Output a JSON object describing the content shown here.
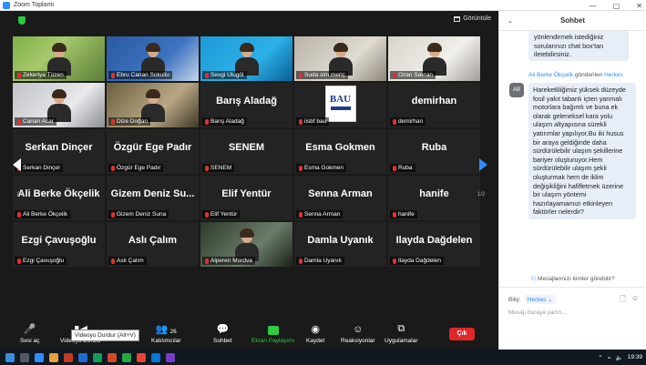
{
  "window": {
    "title": "Zoom Toplantı",
    "controls": [
      "—",
      "▢",
      "✕"
    ]
  },
  "view_button": {
    "label": "Görüntüle"
  },
  "pager": {
    "left": "1/2",
    "right": "1/2"
  },
  "tiles": [
    {
      "name": "Zekeriya Tüzen",
      "type": "video",
      "video_class": "v1"
    },
    {
      "name": "Ebru Canan Sokullu",
      "type": "video",
      "video_class": "v2"
    },
    {
      "name": "Sevgi Ulugöl",
      "type": "video",
      "video_class": "v3"
    },
    {
      "name": "Suda sim meriç",
      "type": "video",
      "video_class": "v4"
    },
    {
      "name": "Ozan Savran",
      "type": "video",
      "video_class": "v5"
    },
    {
      "name": "Canan Acar",
      "type": "video",
      "video_class": "v6"
    },
    {
      "name": "Dize Doğan",
      "type": "video",
      "video_class": "v7",
      "active": true
    },
    {
      "name": "Barış Aladağ",
      "big": "Barış Aladağ",
      "type": "name"
    },
    {
      "name": "iisbf bau",
      "type": "logo",
      "logo_text": "BAU"
    },
    {
      "name": "demirhan",
      "big": "demirhan",
      "type": "name"
    },
    {
      "name": "Serkan Dinçer",
      "big": "Serkan Dinçer",
      "type": "name"
    },
    {
      "name": "Özgür Ege Padır",
      "big": "Özgür Ege Padır",
      "type": "name"
    },
    {
      "name": "SENEM",
      "big": "SENEM",
      "type": "name"
    },
    {
      "name": "Esma Gokmen",
      "big": "Esma Gokmen",
      "type": "name"
    },
    {
      "name": "Ruba",
      "big": "Ruba",
      "type": "name"
    },
    {
      "name": "Ali Berke Ökçelik",
      "big": "Ali Berke Ökçelik",
      "type": "name"
    },
    {
      "name": "Gizem Deniz Suna",
      "big": "Gizem Deniz Su...",
      "type": "name"
    },
    {
      "name": "Elif Yentür",
      "big": "Elif Yentür",
      "type": "name"
    },
    {
      "name": "Senna Arman",
      "big": "Senna Arman",
      "type": "name"
    },
    {
      "name": "hanife",
      "big": "hanife",
      "type": "name"
    },
    {
      "name": "Ezgi Çavuşoğlu",
      "big": "Ezgi Çavuşoğlu",
      "type": "name"
    },
    {
      "name": "Aslı Çalım",
      "big": "Aslı Çalım",
      "type": "name"
    },
    {
      "name": "Alperen Mordva",
      "type": "video",
      "video_class": "v8"
    },
    {
      "name": "Damla Uyanık",
      "big": "Damla Uyanık",
      "type": "name"
    },
    {
      "name": "Ilayda Dağdelen",
      "big": "Ilayda Dağdelen",
      "type": "name"
    }
  ],
  "toolbar": {
    "audio": "Sesi aç",
    "video": "Videoyu Durdur",
    "participants": "Katılımcılar",
    "participants_count": "26",
    "chat": "Sohbet",
    "share": "Ekran Paylaşımı",
    "record": "Kaydet",
    "reactions": "Reaksiyonlar",
    "apps": "Uygulamalar",
    "leave": "Çık",
    "tooltip": "Videoyu Durdur (Alt+V)"
  },
  "chat": {
    "title": "Sohbet",
    "prev_message": "yönlendirmek istediğiniz sorularınızı chat box'tan iletebilirsiniz.",
    "sender_name": "Ali Berke Ökçelik",
    "sender_mid": "gönderilen",
    "sender_to": "Herkes",
    "avatar_initials": "AB",
    "message": "Hareketliliğimiz yüksek düzeyde fosil yakıt tabanlı içten yanmalı motorlara bağımlı ve buna ek olarak geleneksel kara yolu ulaşım altyapısına sürekli yatırımlar yapılıyor.Bu iki husus bir araya geldiğinde daha sürdürülebilir ulaşım şekillerine bariyer oluşturuyor.Hem sürdürülebilir ulaşım şekli oluşturmak hem de iklim değişikliğini hafifletmek üzerine bir ulaşım yöntemi hazırlayamamızı etkinleyen faktörler nelerdir?",
    "who_can_see": "Mesajlarınızı kimler görebilir?",
    "to_label": "Biliy:",
    "to_value": "Herkes",
    "input_placeholder": "Mesajı buraya yazın..."
  },
  "taskbar": {
    "time": "19:39"
  }
}
